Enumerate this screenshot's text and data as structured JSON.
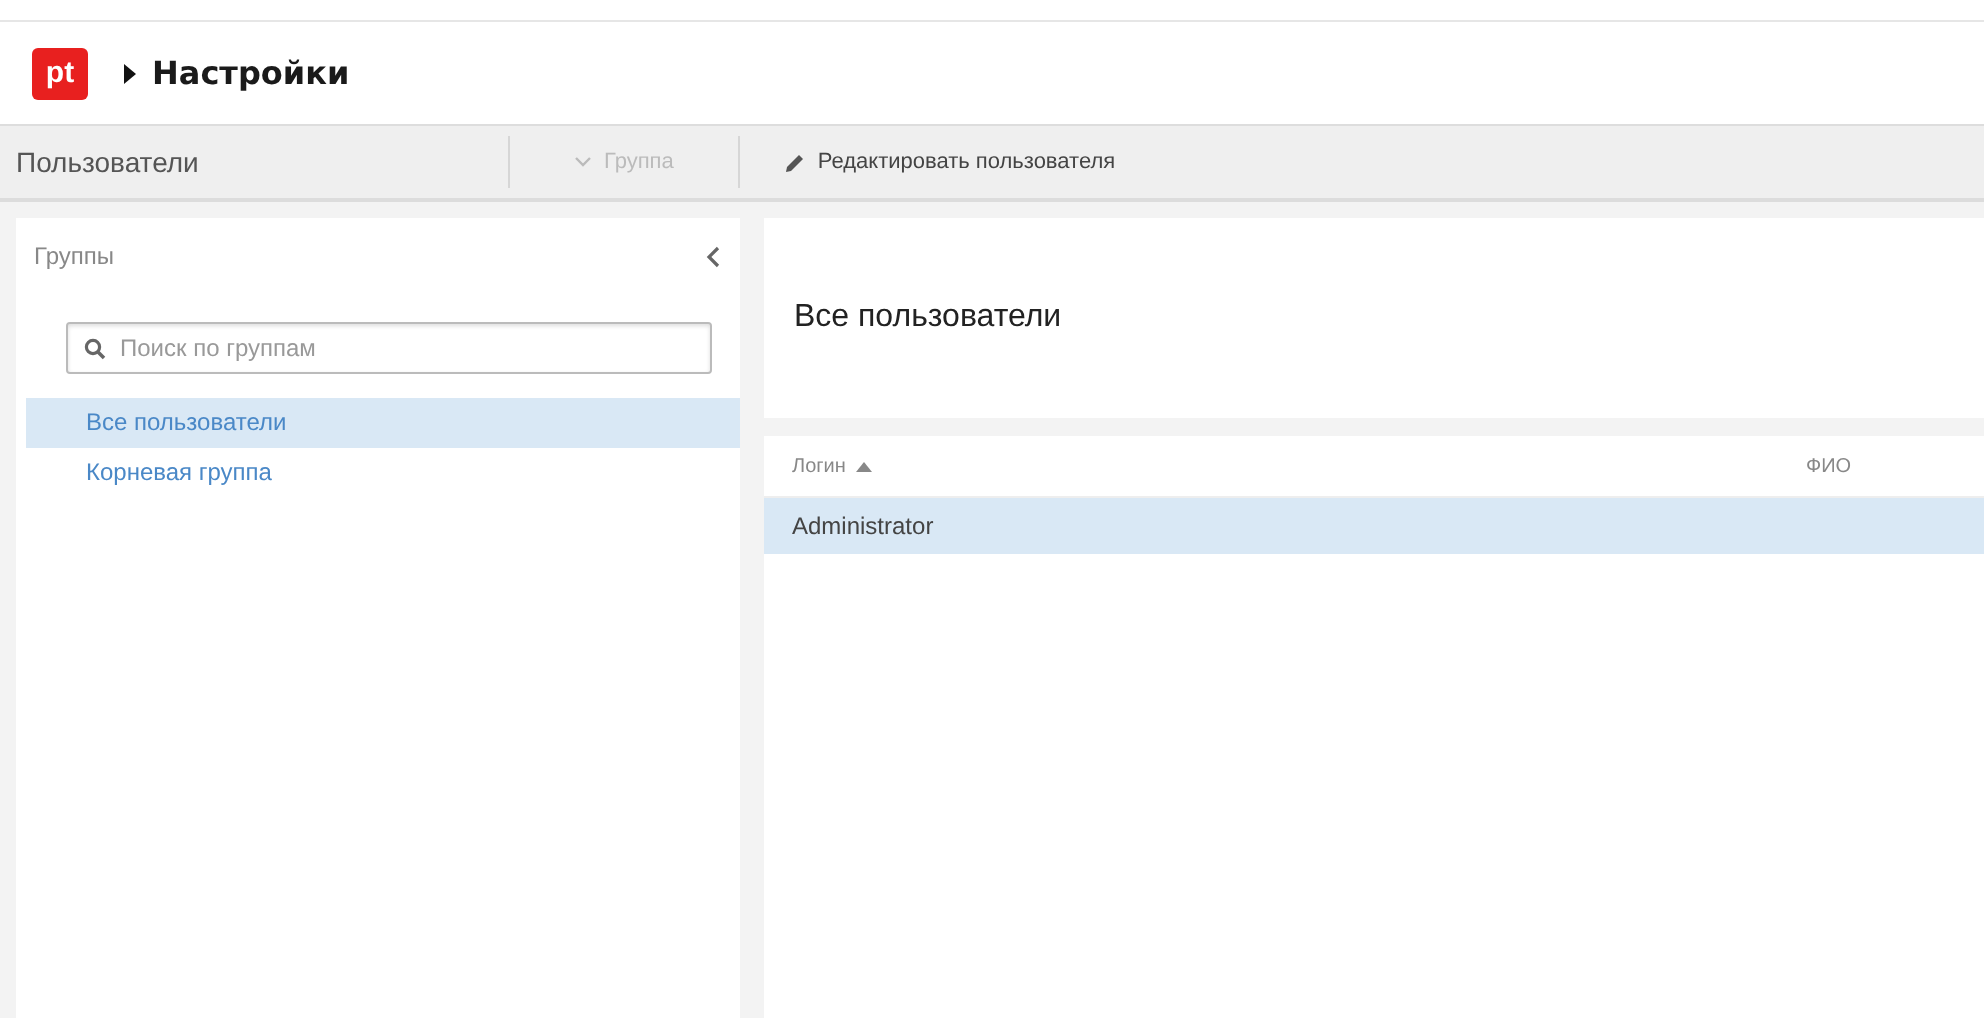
{
  "header": {
    "logo": "pt",
    "title": "Настройки"
  },
  "toolbar": {
    "section": "Пользователи",
    "items": [
      {
        "label": "Группа",
        "disabled": true,
        "kind": "dropdown"
      },
      {
        "label": "Редактировать пользователя",
        "disabled": false,
        "kind": "edit"
      }
    ]
  },
  "sidebar": {
    "title": "Группы",
    "search": {
      "placeholder": "Поиск по группам"
    },
    "items": [
      {
        "label": "Все пользователи",
        "selected": true
      },
      {
        "label": "Корневая группа",
        "selected": false
      }
    ]
  },
  "main": {
    "title": "Все пользователи",
    "table": {
      "columns": [
        {
          "label": "Логин",
          "sorted": true
        },
        {
          "label": "ФИО",
          "sorted": false
        }
      ],
      "rows": [
        {
          "cells": [
            "Administrator"
          ],
          "selected": true
        }
      ]
    }
  }
}
